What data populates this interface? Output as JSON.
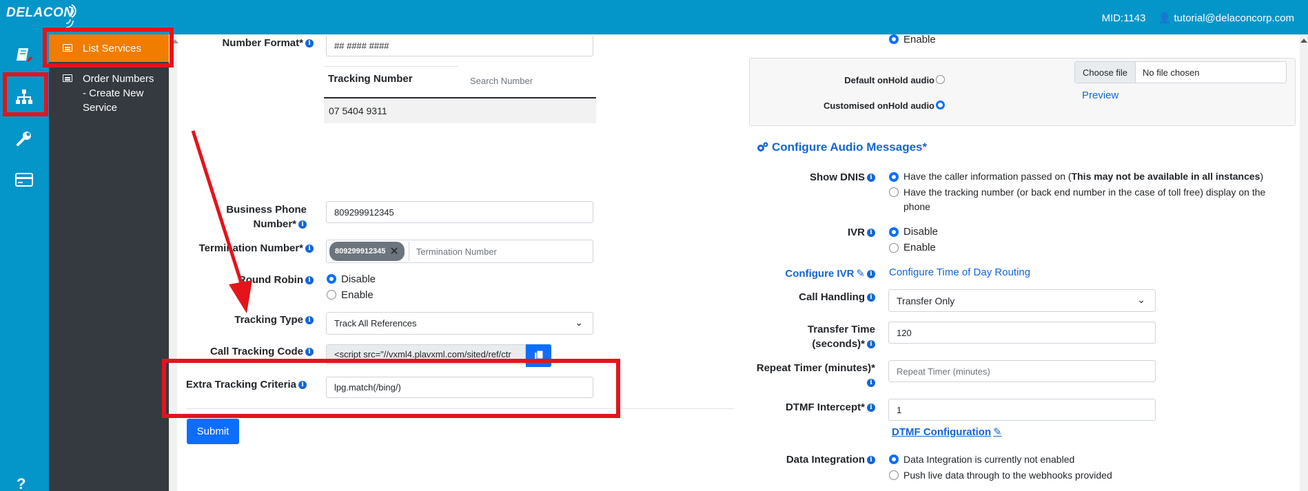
{
  "header": {
    "logo_text": "DELACON",
    "mid": "MID:1143",
    "user": "tutorial@delaconcorp.com"
  },
  "sidebar": {
    "items": [
      {
        "icon": "book-icon"
      },
      {
        "icon": "sitemap-icon"
      },
      {
        "icon": "wrench-icon"
      },
      {
        "icon": "credit-card-icon"
      }
    ],
    "help": "?"
  },
  "submenu": {
    "items": [
      {
        "label": "List Services"
      },
      {
        "label_lines": [
          "Order Numbers",
          "- Create New",
          "Service"
        ]
      }
    ]
  },
  "left_form": {
    "number_format": {
      "label": "Number Format*",
      "value": "## #### ####"
    },
    "tracking_table": {
      "header": "Tracking Number",
      "search_placeholder": "Search Number",
      "row": "07 5404 9311"
    },
    "business_phone": {
      "label_line1": "Business Phone",
      "label_line2": "Number*",
      "value": "809299912345"
    },
    "termination": {
      "label": "Termination Number*",
      "tag": "809299912345",
      "placeholder": "Termination Number"
    },
    "round_robin": {
      "label": "Round Robin",
      "options": [
        "Disable",
        "Enable"
      ],
      "selected": "Disable"
    },
    "tracking_type": {
      "label": "Tracking Type",
      "value": "Track All References"
    },
    "call_tracking_code": {
      "label": "Call Tracking Code",
      "value": "<script src=\"//vxml4.plavxml.com/sited/ref/ctr"
    },
    "extra_tracking": {
      "label": "Extra Tracking Criteria",
      "value": "lpg.match(/bing/)"
    },
    "submit": "Submit"
  },
  "right_form": {
    "enable_top": "Enable",
    "onhold": {
      "default_label": "Default onHold audio",
      "custom_label": "Customised onHold audio",
      "selected": "custom",
      "choose_file": "Choose file",
      "no_file": "No file chosen",
      "preview": "Preview"
    },
    "section_title": "Configure Audio Messages*",
    "show_dnis": {
      "label": "Show DNIS",
      "opt1_pre": "Have the caller information passed on (",
      "opt1_bold": "This may not be available in all instances",
      "opt1_post": ")",
      "opt2_line1": "Have the tracking number (or back end number in the case of toll free) display on the",
      "opt2_line2": "phone",
      "selected": 1
    },
    "ivr": {
      "label": "IVR",
      "options": [
        "Disable",
        "Enable"
      ],
      "selected": "Disable"
    },
    "configure_ivr": {
      "label": "Configure IVR",
      "link": "Configure Time of Day Routing"
    },
    "call_handling": {
      "label": "Call Handling",
      "value": "Transfer Only"
    },
    "transfer_time": {
      "label_line1": "Transfer Time",
      "label_line2": "(seconds)*",
      "value": "120"
    },
    "repeat_timer": {
      "label_line1": "Repeat Timer (minutes)*",
      "placeholder": "Repeat Timer (minutes)"
    },
    "dtmf": {
      "label": "DTMF Intercept*",
      "value": "1",
      "config_link": "DTMF Configuration"
    },
    "data_integration": {
      "label": "Data Integration",
      "options": [
        "Data Integration is currently not enabled",
        "Push live data through to the webhooks provided"
      ],
      "selected": 0
    }
  },
  "colors": {
    "topbar": "#0495c9",
    "submenu": "#343a40",
    "active_item": "#f07d00",
    "primary": "#0d6efd",
    "annotation": "#e3141b"
  }
}
